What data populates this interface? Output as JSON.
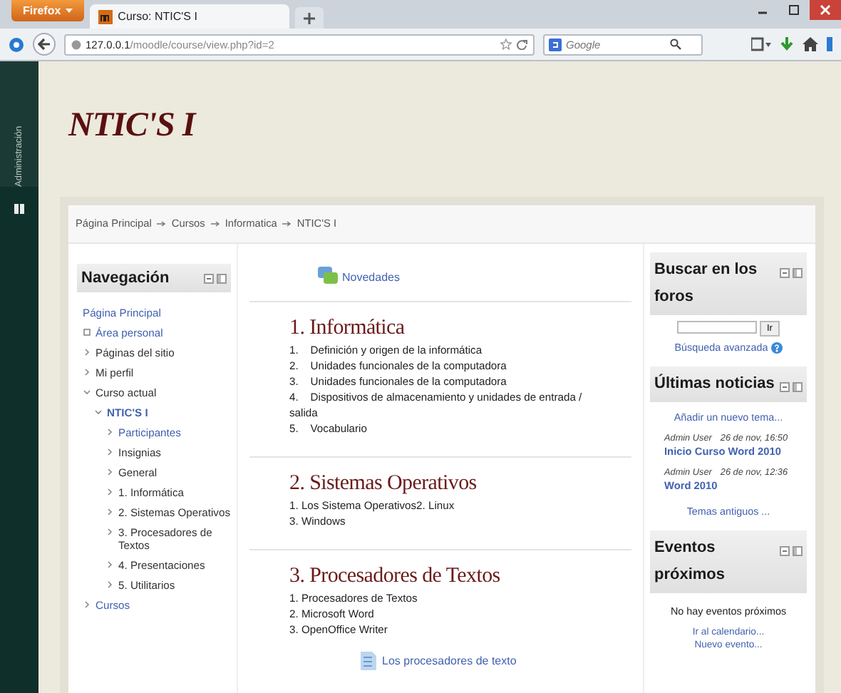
{
  "browser": {
    "menu_button": "Firefox",
    "tab_title": "Curso: NTIC'S I",
    "url_host": "127.0.0.1",
    "url_path": "/moodle/course/view.php?id=2",
    "search_placeholder": "Google"
  },
  "admin_rail": {
    "label": "Administración"
  },
  "site_title": "NTIC'S I",
  "breadcrumb": [
    "Página Principal",
    "Cursos",
    "Informatica",
    "NTIC'S I"
  ],
  "navigation": {
    "title": "Navegación",
    "items": [
      {
        "label": "Página Principal",
        "kind": "home",
        "link": true,
        "current": false
      },
      {
        "label": "Área personal",
        "kind": "leaf",
        "link": true,
        "current": false
      },
      {
        "label": "Páginas del sitio",
        "kind": "branch",
        "expanded": false,
        "link": false,
        "current": false
      },
      {
        "label": "Mi perfil",
        "kind": "branch",
        "expanded": false,
        "link": false,
        "current": false
      },
      {
        "label": "Curso actual",
        "kind": "branch",
        "expanded": true,
        "link": false,
        "current": false,
        "children": [
          {
            "label": "NTIC'S I",
            "kind": "branch",
            "expanded": true,
            "link": true,
            "current": true,
            "children": [
              {
                "label": "Participantes",
                "kind": "branch",
                "expanded": false,
                "link": true,
                "current": false
              },
              {
                "label": "Insignias",
                "kind": "branch",
                "expanded": false,
                "link": false,
                "current": false
              },
              {
                "label": "General",
                "kind": "branch",
                "expanded": false,
                "link": false,
                "current": false
              },
              {
                "label": "1. Informática",
                "kind": "branch",
                "expanded": false,
                "link": false,
                "current": false
              },
              {
                "label": "2. Sistemas Operativos",
                "kind": "branch",
                "expanded": false,
                "link": false,
                "current": false
              },
              {
                "label": "3. Procesadores de Textos",
                "kind": "branch",
                "expanded": false,
                "link": false,
                "current": false
              },
              {
                "label": "4. Presentaciones",
                "kind": "branch",
                "expanded": false,
                "link": false,
                "current": false
              },
              {
                "label": "5. Utilitarios",
                "kind": "branch",
                "expanded": false,
                "link": false,
                "current": false
              }
            ]
          }
        ]
      },
      {
        "label": "Cursos",
        "kind": "branch",
        "expanded": false,
        "link": true,
        "current": false
      }
    ]
  },
  "news_forum": {
    "label": "Novedades"
  },
  "sections": [
    {
      "title": "1. Informática",
      "lines": [
        "1.    Definición y origen de la informática",
        "2.    Unidades funcionales de la computadora",
        "3.    Unidades funcionales de la computadora",
        "4.    Dispositivos de almacenamiento y unidades de entrada / salida",
        "5.    Vocabulario"
      ]
    },
    {
      "title": "2. Sistemas Operativos",
      "lines": [
        "1. Los Sistema Operativos2. Linux",
        "3. Windows"
      ]
    },
    {
      "title": "3. Procesadores de Textos",
      "lines": [
        "1. Procesadores de Textos",
        "2. Microsoft Word",
        "3. OpenOffice Writer"
      ],
      "resources": [
        {
          "label": "Los procesadores de texto"
        }
      ]
    }
  ],
  "forum_search": {
    "title": "Buscar en los foros",
    "button": "Ir",
    "advanced_link": "Búsqueda avanzada"
  },
  "latest_news": {
    "title": "Últimas noticias",
    "add_link": "Añadir un nuevo tema...",
    "posts": [
      {
        "author": "Admin User",
        "date": "26 de nov, 16:50",
        "title": "Inicio Curso Word 2010"
      },
      {
        "author": "Admin User",
        "date": "26 de nov, 12:36",
        "title": "Word 2010"
      }
    ],
    "older_link": "Temas antiguos ..."
  },
  "upcoming_events": {
    "title": "Eventos próximos",
    "message": "No hay eventos próximos",
    "links": [
      "Ir al calendario...",
      "Nuevo evento..."
    ]
  }
}
